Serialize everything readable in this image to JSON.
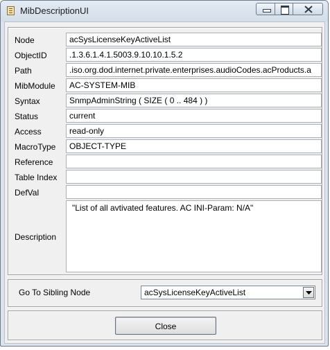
{
  "window": {
    "title": "MibDescriptionUI"
  },
  "fields": [
    {
      "label": "Node",
      "value": "acSysLicenseKeyActiveList"
    },
    {
      "label": "ObjectID",
      "value": ".1.3.6.1.4.1.5003.9.10.10.1.5.2"
    },
    {
      "label": "Path",
      "value": ".iso.org.dod.internet.private.enterprises.audioCodes.acProducts.a"
    },
    {
      "label": "MibModule",
      "value": "AC-SYSTEM-MIB"
    },
    {
      "label": "Syntax",
      "value": "SnmpAdminString  ( SIZE ( 0 .. 484  ) )"
    },
    {
      "label": "Status",
      "value": "current"
    },
    {
      "label": "Access",
      "value": "read-only"
    },
    {
      "label": "MacroType",
      "value": "OBJECT-TYPE"
    },
    {
      "label": "Reference",
      "value": ""
    },
    {
      "label": "Table Index",
      "value": ""
    },
    {
      "label": "DefVal",
      "value": ""
    }
  ],
  "description": {
    "label": "Description",
    "value": "\"List of all avtivated features. AC INI-Param: N/A\""
  },
  "sibling": {
    "label": "Go To Sibling Node",
    "selected": "acSysLicenseKeyActiveList"
  },
  "close_button": {
    "label": "Close"
  },
  "icons": {
    "app": "document-icon",
    "minimize": "minimize-icon",
    "maximize": "maximize-icon",
    "close": "close-icon",
    "dropdown": "chevron-down-icon"
  }
}
